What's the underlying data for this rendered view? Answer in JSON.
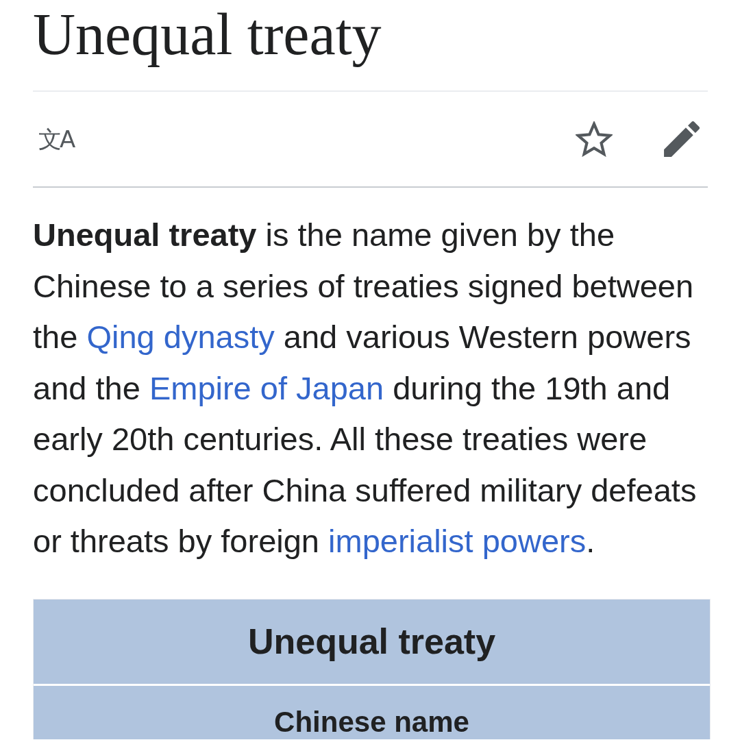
{
  "title": "Unequal treaty",
  "toolbar": {
    "language": "文A",
    "watched": false
  },
  "lead": [
    {
      "kind": "text",
      "text": "**Unequal treaty** is the name given by the Chinese to a series of treaties signed between the "
    },
    {
      "kind": "link",
      "text": "Qing dynasty"
    },
    {
      "kind": "text",
      "text": " and various Western powers and the "
    },
    {
      "kind": "link",
      "text": "Empire of Japan"
    },
    {
      "kind": "text",
      "text": " during the 19th and early 20th centuries. All these treaties were concluded after China suffered military defeats or threats by foreign "
    },
    {
      "kind": "link",
      "text": "imperialist powers"
    },
    {
      "kind": "text",
      "text": "."
    }
  ],
  "infobox": {
    "title": "Unequal treaty",
    "rows": [
      {
        "kind": "header",
        "text": "Chinese name"
      }
    ]
  }
}
